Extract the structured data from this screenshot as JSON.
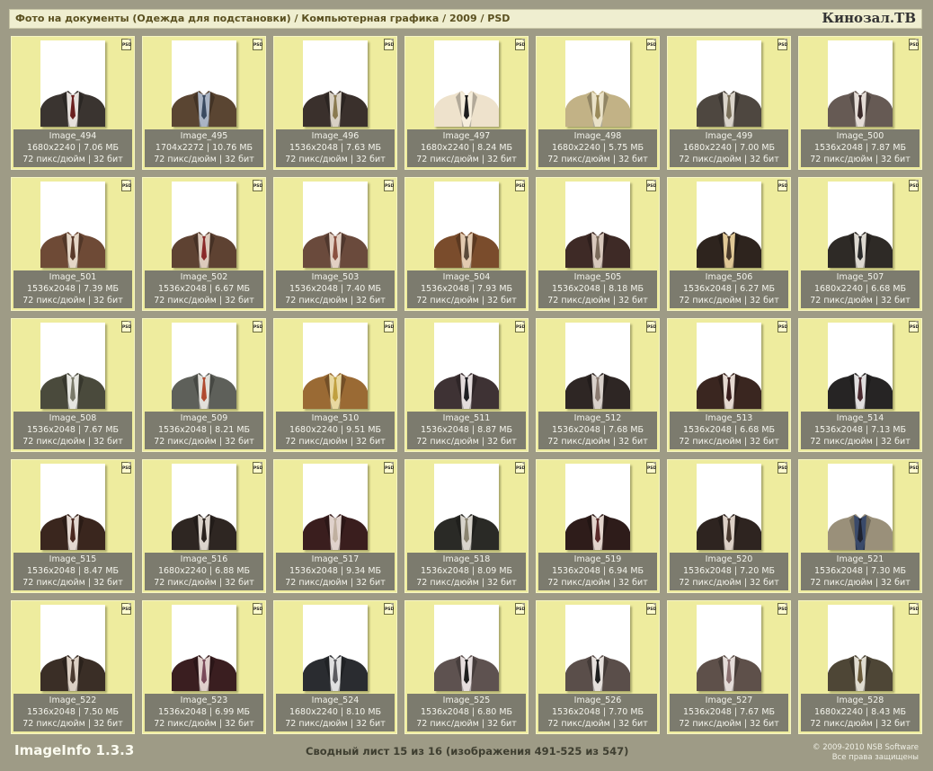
{
  "header": {
    "path": "Фото на документы (Одежда для подстановки) / Компьютерная графика / 2009 / PSD",
    "brand": "Кинозал.ТВ"
  },
  "badge_label": "PSD",
  "images": [
    {
      "name": "Image_494",
      "dims": "1680x2240 | 7.06 МБ",
      "meta": "72 пикс/дюйм | 32 бит",
      "jacket": "#3a3430",
      "shirt": "#e6e0dc",
      "tie": "#6a1f1f"
    },
    {
      "name": "Image_495",
      "dims": "1704x2272 | 10.76 МБ",
      "meta": "72 пикс/дюйм | 32 бит",
      "jacket": "#5a4532",
      "shirt": "#aab4c4",
      "tie": "#3a4a60"
    },
    {
      "name": "Image_496",
      "dims": "1536x2048 | 7.63 МБ",
      "meta": "72 пикс/дюйм | 32 бит",
      "jacket": "#3a302c",
      "shirt": "#d8d0c4",
      "tie": "#8a7a50"
    },
    {
      "name": "Image_497",
      "dims": "1680x2240 | 8.24 МБ",
      "meta": "72 пикс/дюйм | 32 бит",
      "jacket": "#eee2cc",
      "shirt": "#f6eedc",
      "tie": "#1e1e1e"
    },
    {
      "name": "Image_498",
      "dims": "1680x2240 | 5.75 МБ",
      "meta": "72 пикс/дюйм | 32 бит",
      "jacket": "#c2b286",
      "shirt": "#eae2c8",
      "tie": "#9a8a5a"
    },
    {
      "name": "Image_499",
      "dims": "1680x2240 | 7.00 МБ",
      "meta": "72 пикс/дюйм | 32 бит",
      "jacket": "#4e4740",
      "shirt": "#dad4ca",
      "tie": "#7a705a"
    },
    {
      "name": "Image_500",
      "dims": "1536x2048 | 7.87 МБ",
      "meta": "72 пикс/дюйм | 32 бит",
      "jacket": "#665a54",
      "shirt": "#e4dcd6",
      "tie": "#3a2a2a"
    },
    {
      "name": "Image_501",
      "dims": "1536x2048 | 7.39 МБ",
      "meta": "72 пикс/дюйм | 32 бит",
      "jacket": "#6e4a36",
      "shirt": "#e4d6c6",
      "tie": "#5a3a2a"
    },
    {
      "name": "Image_502",
      "dims": "1536x2048 | 6.67 МБ",
      "meta": "72 пикс/дюйм | 32 бит",
      "jacket": "#5e4232",
      "shirt": "#dccabc",
      "tie": "#8a2a2a"
    },
    {
      "name": "Image_503",
      "dims": "1536x2048 | 7.40 МБ",
      "meta": "72 пикс/дюйм | 32 бит",
      "jacket": "#6a4a3c",
      "shirt": "#e2d0c4",
      "tie": "#8a5040"
    },
    {
      "name": "Image_504",
      "dims": "1536x2048 | 7.93 МБ",
      "meta": "72 пикс/дюйм | 32 бит",
      "jacket": "#7a4c2c",
      "shirt": "#e2cab0",
      "tie": "#5a4a3a"
    },
    {
      "name": "Image_505",
      "dims": "1536x2048 | 8.18 МБ",
      "meta": "72 пикс/дюйм | 32 бит",
      "jacket": "#3e2a26",
      "shirt": "#d8c8bc",
      "tie": "#7a6a5a"
    },
    {
      "name": "Image_506",
      "dims": "1536x2048 | 6.27 МБ",
      "meta": "72 пикс/дюйм | 32 бит",
      "jacket": "#2e241e",
      "shirt": "#e0c896",
      "tie": "#4a3a2a"
    },
    {
      "name": "Image_507",
      "dims": "1680x2240 | 6.68 МБ",
      "meta": "72 пикс/дюйм | 32 бит",
      "jacket": "#2e2a26",
      "shirt": "#dcd8d0",
      "tie": "#2a2a2a"
    },
    {
      "name": "Image_508",
      "dims": "1536x2048 | 7.67 МБ",
      "meta": "72 пикс/дюйм | 32 бит",
      "jacket": "#4a4a3c",
      "shirt": "#e6e6e0",
      "tie": "#7a7a6a"
    },
    {
      "name": "Image_509",
      "dims": "1536x2048 | 8.21 МБ",
      "meta": "72 пикс/дюйм | 32 бит",
      "jacket": "#5e605a",
      "shirt": "#e2e0da",
      "tie": "#b04a30"
    },
    {
      "name": "Image_510",
      "dims": "1680x2240 | 9.51 МБ",
      "meta": "72 пикс/дюйм | 32 бит",
      "jacket": "#9a6a34",
      "shirt": "#e8d8a0",
      "tie": "#c0a040"
    },
    {
      "name": "Image_511",
      "dims": "1536x2048 | 8.87 МБ",
      "meta": "72 пикс/дюйм | 32 бит",
      "jacket": "#3e3234",
      "shirt": "#e4dcdc",
      "tie": "#1e1e22"
    },
    {
      "name": "Image_512",
      "dims": "1536x2048 | 7.68 МБ",
      "meta": "72 пикс/дюйм | 32 бит",
      "jacket": "#2e2624",
      "shirt": "#d8d0ca",
      "tie": "#8a7a70"
    },
    {
      "name": "Image_513",
      "dims": "1536x2048 | 6.68 МБ",
      "meta": "72 пикс/дюйм | 32 бит",
      "jacket": "#3a2620",
      "shirt": "#e4d8d0",
      "tie": "#3a1e1e"
    },
    {
      "name": "Image_514",
      "dims": "1536x2048 | 7.13 МБ",
      "meta": "72 пикс/дюйм | 32 бит",
      "jacket": "#262424",
      "shirt": "#e0dede",
      "tie": "#4a2a30"
    },
    {
      "name": "Image_515",
      "dims": "1536x2048 | 8.47 МБ",
      "meta": "72 пикс/дюйм | 32 бит",
      "jacket": "#3a261e",
      "shirt": "#e4d8d0",
      "tie": "#4a2820"
    },
    {
      "name": "Image_516",
      "dims": "1680x2240 | 6.88 МБ",
      "meta": "72 пикс/дюйм | 32 бит",
      "jacket": "#2e2622",
      "shirt": "#dcd4cc",
      "tie": "#2a221e"
    },
    {
      "name": "Image_517",
      "dims": "1536x2048 | 9.34 МБ",
      "meta": "72 пикс/дюйм | 32 бит",
      "jacket": "#3a1e1e",
      "shirt": "#e0d2cc",
      "tie": "#c0b0a0"
    },
    {
      "name": "Image_518",
      "dims": "1536x2048 | 8.09 МБ",
      "meta": "72 пикс/дюйм | 32 бит",
      "jacket": "#2a2a26",
      "shirt": "#d8d4cc",
      "tie": "#8a8470"
    },
    {
      "name": "Image_519",
      "dims": "1536x2048 | 6.94 МБ",
      "meta": "72 пикс/дюйм | 32 бит",
      "jacket": "#2e1c1a",
      "shirt": "#e2d4cc",
      "tie": "#5a2a2a"
    },
    {
      "name": "Image_520",
      "dims": "1536x2048 | 7.20 МБ",
      "meta": "72 пикс/дюйм | 32 бит",
      "jacket": "#2e2420",
      "shirt": "#dcd0c6",
      "tie": "#4a3a30"
    },
    {
      "name": "Image_521",
      "dims": "1536x2048 | 7.30 МБ",
      "meta": "72 пикс/дюйм | 32 бит",
      "jacket": "#9a907a",
      "shirt": "#3a4a6a",
      "tie": "#1e2230"
    },
    {
      "name": "Image_522",
      "dims": "1536x2048 | 7.50 МБ",
      "meta": "72 пикс/дюйм | 32 бит",
      "jacket": "#3a2e26",
      "shirt": "#dcd0c4",
      "tie": "#4a3a30"
    },
    {
      "name": "Image_523",
      "dims": "1536x2048 | 6.99 МБ",
      "meta": "72 пикс/дюйм | 32 бит",
      "jacket": "#3a1e20",
      "shirt": "#e0d0cc",
      "tie": "#7a4a5a"
    },
    {
      "name": "Image_524",
      "dims": "1680x2240 | 8.10 МБ",
      "meta": "72 пикс/дюйм | 32 бит",
      "jacket": "#2a2c30",
      "shirt": "#e0e0e0",
      "tie": "#5a5a5e"
    },
    {
      "name": "Image_525",
      "dims": "1536x2048 | 6.80 МБ",
      "meta": "72 пикс/дюйм | 32 бит",
      "jacket": "#5e5250",
      "shirt": "#e6dede",
      "tie": "#1e1e1e"
    },
    {
      "name": "Image_526",
      "dims": "1536x2048 | 7.70 МБ",
      "meta": "72 пикс/дюйм | 32 бит",
      "jacket": "#5a4e4a",
      "shirt": "#e6e0dc",
      "tie": "#1e1e1e"
    },
    {
      "name": "Image_527",
      "dims": "1536x2048 | 7.67 МБ",
      "meta": "72 пикс/дюйм | 32 бит",
      "jacket": "#5e504a",
      "shirt": "#e4dcd8",
      "tie": "#8a7070"
    },
    {
      "name": "Image_528",
      "dims": "1680x2240 | 8.43 МБ",
      "meta": "72 пикс/дюйм | 32 бит",
      "jacket": "#4e4636",
      "shirt": "#e0dcd0",
      "tie": "#6a5a3a"
    }
  ],
  "footer": {
    "app": "ImageInfo 1.3.3",
    "status": "Сводный лист 15 из 16 (изображения 491-525 из 547)",
    "copyright": "© 2009-2010 NSB Software",
    "rights": "Все права защищены"
  }
}
